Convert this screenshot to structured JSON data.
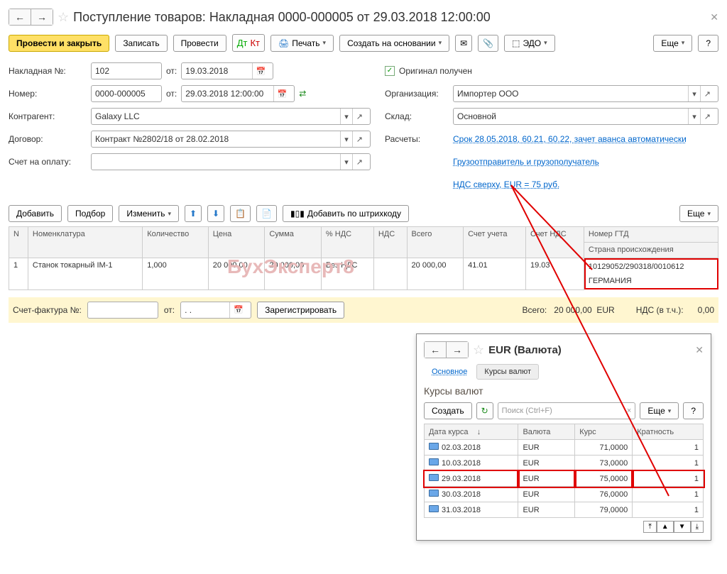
{
  "title": "Поступление товаров: Накладная 0000-000005 от 29.03.2018 12:00:00",
  "toolbar": {
    "post_close": "Провести и закрыть",
    "save": "Записать",
    "post": "Провести",
    "print": "Печать",
    "create_based": "Создать на основании",
    "edo": "ЭДО",
    "more": "Еще",
    "help": "?"
  },
  "form": {
    "invoice_no_label": "Накладная №:",
    "invoice_no": "102",
    "from_label": "от:",
    "invoice_date": "19.03.2018",
    "number_label": "Номер:",
    "number": "0000-000005",
    "number_date": "29.03.2018 12:00:00",
    "contractor_label": "Контрагент:",
    "contractor": "Galaxy LLC",
    "contract_label": "Договор:",
    "contract": "Контракт №2802/18 от 28.02.2018",
    "invoice_for_payment_label": "Счет на оплату:",
    "invoice_for_payment": "",
    "original_received": "Оригинал получен",
    "org_label": "Организация:",
    "org": "Импортер ООО",
    "warehouse_label": "Склад:",
    "warehouse": "Основной",
    "settlements_label": "Расчеты:",
    "settlements_link": "Срок 28.05.2018, 60.21, 60.22, зачет аванса автоматически",
    "shipper_link": "Грузоотправитель и грузополучатель",
    "vat_link": "НДС сверху, EUR = 75 руб."
  },
  "table_toolbar": {
    "add": "Добавить",
    "select": "Подбор",
    "edit": "Изменить",
    "add_by_barcode": "Добавить по штрихкоду",
    "more": "Еще"
  },
  "columns": {
    "n": "N",
    "nomenclature": "Номенклатура",
    "qty": "Количество",
    "price": "Цена",
    "sum": "Сумма",
    "vat_pct": "% НДС",
    "vat": "НДС",
    "total": "Всего",
    "acct": "Счет учета",
    "vat_acct": "Счет НДС",
    "gtd": "Номер ГТД",
    "origin": "Страна происхождения"
  },
  "rows": [
    {
      "n": "1",
      "nomenclature": "Станок токарный IM-1",
      "qty": "1,000",
      "price": "20 000,00",
      "sum": "20 000,00",
      "vat_pct": "Без НДС",
      "vat": "",
      "total": "20 000,00",
      "acct": "41.01",
      "vat_acct": "19.03",
      "gtd": "10129052/290318/0010612",
      "origin": "ГЕРМАНИЯ"
    }
  ],
  "footer": {
    "sf_label": "Счет-фактура №:",
    "sf_from": "от:",
    "sf_date": ". .",
    "register": "Зарегистрировать",
    "total_label": "Всего:",
    "total_value": "20 000,00",
    "total_ccy": "EUR",
    "vat_incl_label": "НДС (в т.ч.):",
    "vat_incl_value": "0,00"
  },
  "sub": {
    "title": "EUR (Валюта)",
    "tab_main": "Основное",
    "tab_rates": "Курсы валют",
    "section": "Курсы валют",
    "create": "Создать",
    "search_placeholder": "Поиск (Ctrl+F)",
    "more": "Еще",
    "help": "?",
    "col_date": "Дата курса",
    "col_ccy": "Валюта",
    "col_rate": "Курс",
    "col_mult": "Кратность",
    "rows": [
      {
        "date": "02.03.2018",
        "ccy": "EUR",
        "rate": "71,0000",
        "mult": "1"
      },
      {
        "date": "10.03.2018",
        "ccy": "EUR",
        "rate": "73,0000",
        "mult": "1"
      },
      {
        "date": "29.03.2018",
        "ccy": "EUR",
        "rate": "75,0000",
        "mult": "1"
      },
      {
        "date": "30.03.2018",
        "ccy": "EUR",
        "rate": "76,0000",
        "mult": "1"
      },
      {
        "date": "31.03.2018",
        "ccy": "EUR",
        "rate": "79,0000",
        "mult": "1"
      }
    ]
  },
  "watermark": "БухЭксперт8"
}
